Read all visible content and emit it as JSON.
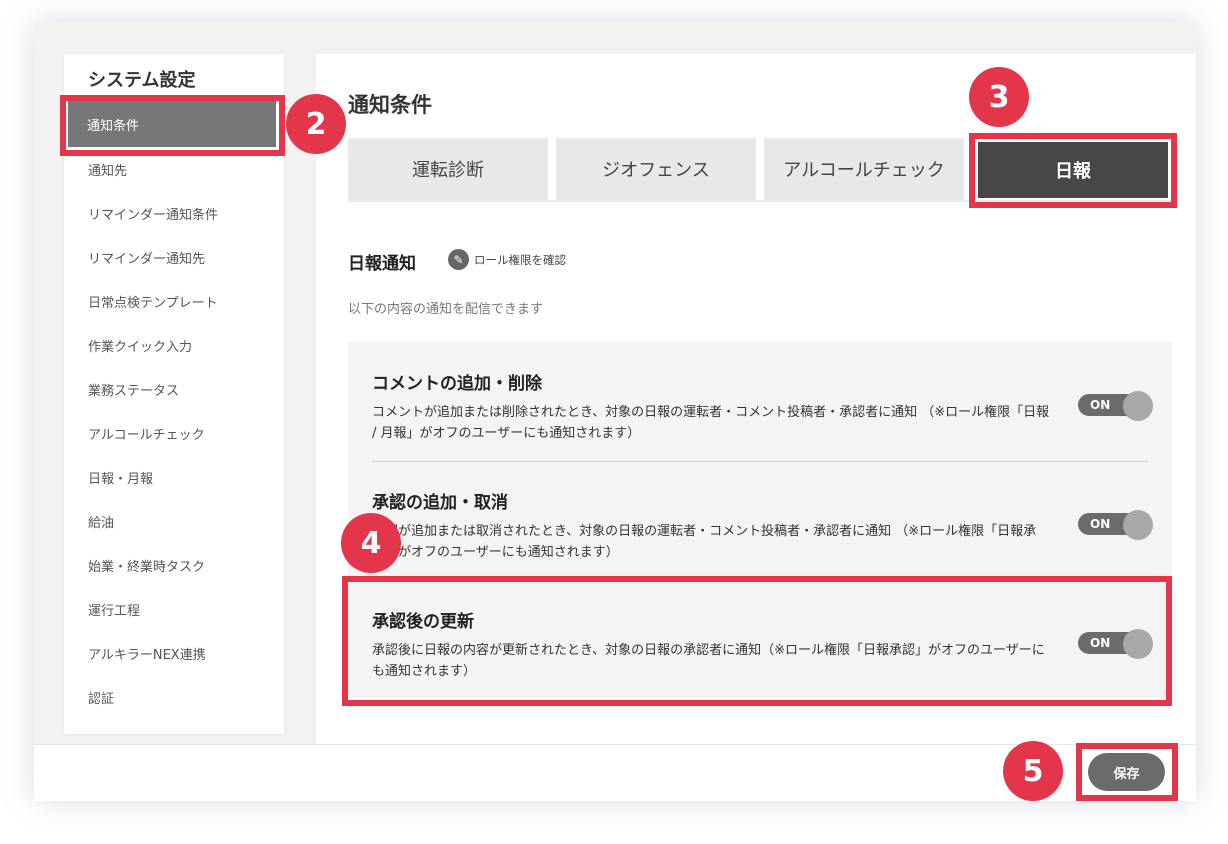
{
  "sidebar": {
    "title": "システム設定",
    "items": [
      {
        "label": "通知条件"
      },
      {
        "label": "通知先"
      },
      {
        "label": "リマインダー通知条件"
      },
      {
        "label": "リマインダー通知先"
      },
      {
        "label": "日常点検テンプレート"
      },
      {
        "label": "作業クイック入力"
      },
      {
        "label": "業務ステータス"
      },
      {
        "label": "アルコールチェック"
      },
      {
        "label": "日報・月報"
      },
      {
        "label": "給油"
      },
      {
        "label": "始業・終業時タスク"
      },
      {
        "label": "運行工程"
      },
      {
        "label": "アルキラーNEX連携"
      },
      {
        "label": "認証"
      }
    ]
  },
  "main": {
    "title": "通知条件",
    "tabs": [
      {
        "label": "運転診断"
      },
      {
        "label": "ジオフェンス"
      },
      {
        "label": "アルコールチェック"
      },
      {
        "label": "日報"
      }
    ],
    "section_title": "日報通知",
    "role_link": "ロール権限を確認",
    "description": "以下の内容の通知を配信できます",
    "items": [
      {
        "title": "コメントの追加・削除",
        "body": "コメントが追加または削除されたとき、対象の日報の運転者・コメント投稿者・承認者に通知 （※ロール権限「日報 / 月報」がオフのユーザーにも通知されます）",
        "toggle": "ON"
      },
      {
        "title": "承認の追加・取消",
        "body": "承認が追加または取消されたとき、対象の日報の運転者・コメント投稿者・承認者に通知 （※ロール権限「日報承認」がオフのユーザーにも通知されます）",
        "toggle": "ON"
      },
      {
        "title": "承認後の更新",
        "body": "承認後に日報の内容が更新されたとき、対象の日報の承認者に通知（※ロール権限「日報承認」がオフのユーザーにも通知されます）",
        "toggle": "ON"
      }
    ]
  },
  "footer": {
    "save_label": "保存"
  },
  "annotations": {
    "badges": [
      "2",
      "3",
      "4",
      "5"
    ],
    "color": "#e4364a"
  }
}
